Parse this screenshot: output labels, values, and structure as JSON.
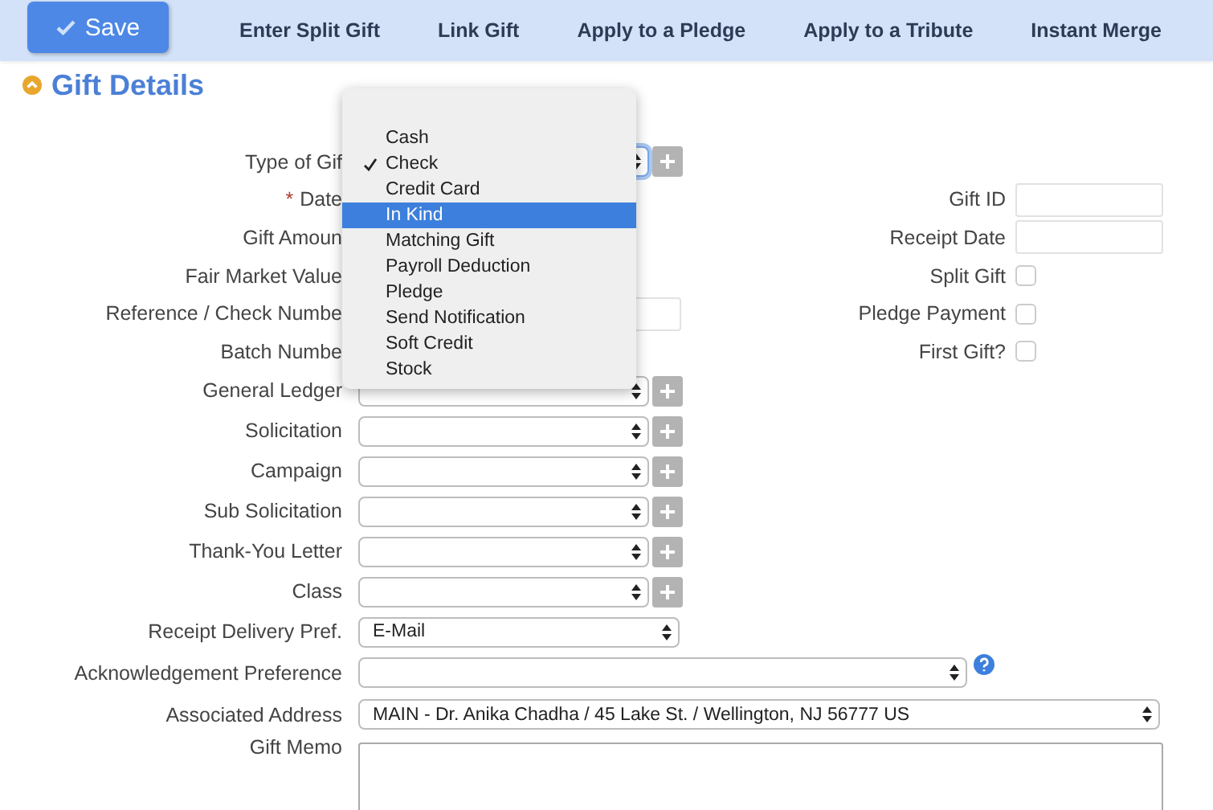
{
  "toolbar": {
    "save": "Save",
    "actions": [
      "Enter Split Gift",
      "Link Gift",
      "Apply to a Pledge",
      "Apply to a Tribute",
      "Instant Merge"
    ]
  },
  "section": {
    "title": "Gift Details",
    "expanded": true
  },
  "fields": [
    {
      "label": "Type of Gif",
      "kind": "select_add",
      "focused": true
    },
    {
      "label": "Date",
      "required_mark": "*",
      "kind": "covered"
    },
    {
      "label": "Gift Amoun",
      "kind": "covered"
    },
    {
      "label": "Fair Market Value",
      "kind": "covered"
    },
    {
      "label": "Reference / Check Numbe",
      "kind": "text"
    },
    {
      "label": "Batch Numbe",
      "kind": "covered"
    },
    {
      "label": "General Ledger",
      "kind": "select_add"
    },
    {
      "label": "Solicitation",
      "kind": "select_add"
    },
    {
      "label": "Campaign",
      "kind": "select_add"
    },
    {
      "label": "Sub Solicitation",
      "kind": "select_add"
    },
    {
      "label": "Thank-You Letter",
      "kind": "select_add"
    },
    {
      "label": "Class",
      "kind": "select_add"
    },
    {
      "label": "Receipt Delivery Pref.",
      "kind": "select",
      "value": "E-Mail"
    },
    {
      "label": "Acknowledgement Preference",
      "kind": "select_wide",
      "help": true
    },
    {
      "label": "Associated Address",
      "kind": "select_full",
      "value": "MAIN - Dr. Anika Chadha / 45 Lake St. / Wellington, NJ 56777 US"
    },
    {
      "label": "Gift Memo",
      "kind": "textarea"
    }
  ],
  "right_fields": [
    {
      "label": "Gift ID",
      "kind": "text"
    },
    {
      "label": "Receipt Date",
      "kind": "text"
    },
    {
      "label": "Split Gift",
      "kind": "checkbox",
      "checked": false
    },
    {
      "label": "Pledge Payment",
      "kind": "checkbox",
      "checked": false
    },
    {
      "label": "First Gift?",
      "kind": "checkbox",
      "checked": false
    }
  ],
  "type_menu": {
    "options": [
      {
        "label": "Cash",
        "checked": false,
        "selected": false
      },
      {
        "label": "Check",
        "checked": true,
        "selected": false
      },
      {
        "label": "Credit Card",
        "checked": false,
        "selected": false
      },
      {
        "label": "In Kind",
        "checked": false,
        "selected": true
      },
      {
        "label": "Matching Gift",
        "checked": false,
        "selected": false
      },
      {
        "label": "Payroll Deduction",
        "checked": false,
        "selected": false
      },
      {
        "label": "Pledge",
        "checked": false,
        "selected": false
      },
      {
        "label": "Send Notification",
        "checked": false,
        "selected": false
      },
      {
        "label": "Soft Credit",
        "checked": false,
        "selected": false
      },
      {
        "label": "Stock",
        "checked": false,
        "selected": false
      }
    ]
  }
}
